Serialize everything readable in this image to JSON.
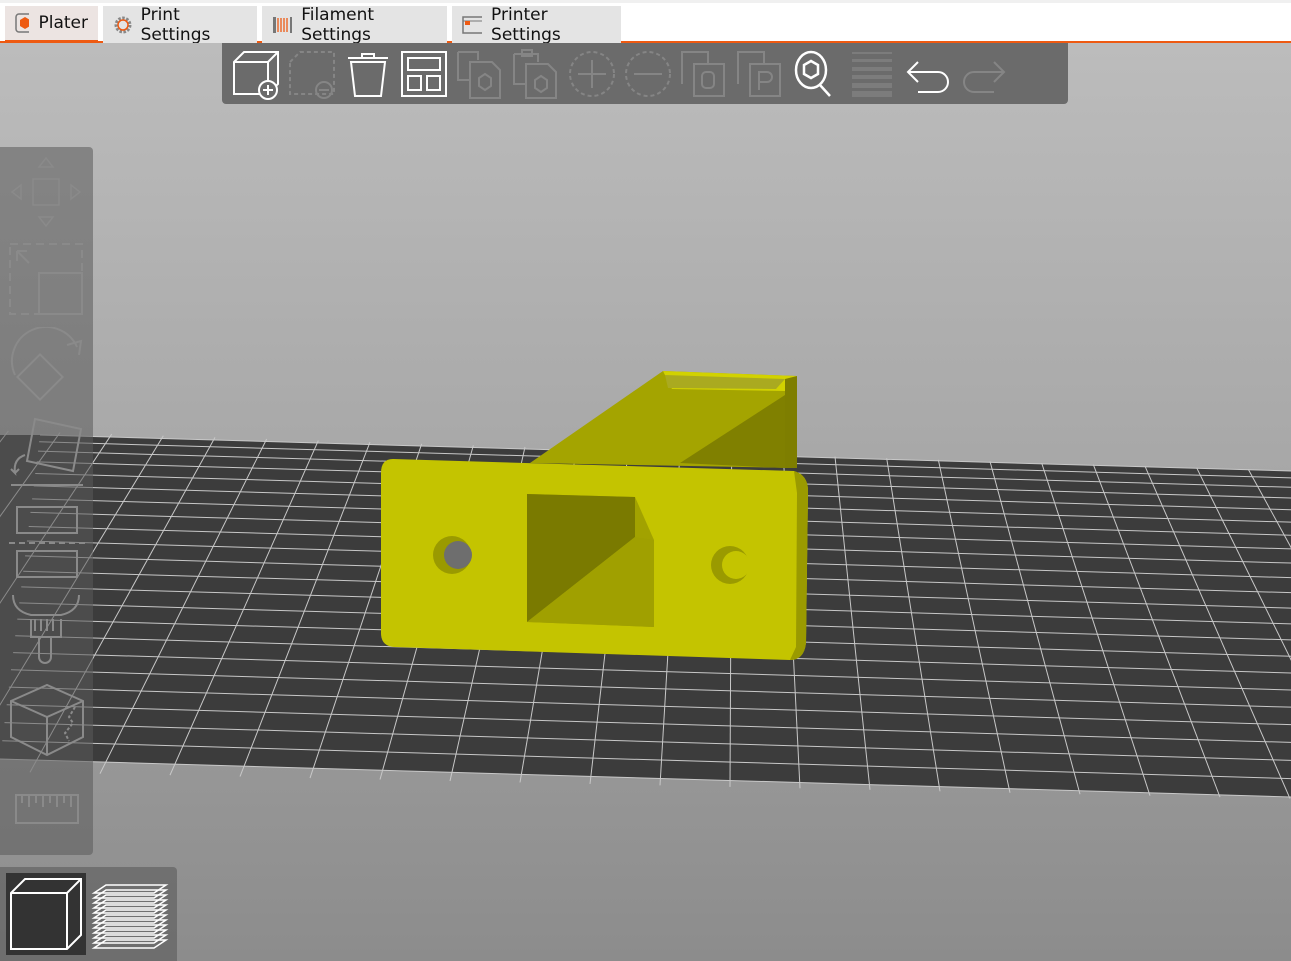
{
  "tabs": [
    {
      "label": "Plater",
      "icon": "plater-icon"
    },
    {
      "label": "Print Settings",
      "icon": "gear-icon"
    },
    {
      "label": "Filament Settings",
      "icon": "filament-spool-icon"
    },
    {
      "label": "Printer Settings",
      "icon": "printer-icon"
    }
  ],
  "toolbar": [
    "add-object",
    "delete-object",
    "delete-all",
    "arrange",
    "copy",
    "paste",
    "add-instance",
    "remove-instance",
    "split-to-objects",
    "split-to-parts",
    "search",
    "layer-editing",
    "undo",
    "redo"
  ],
  "sidebar_tools": [
    "move",
    "scale",
    "rotate",
    "place-on-face",
    "cut",
    "paint-supports",
    "seam-painting",
    "measure"
  ],
  "view_switch": [
    "3d-view",
    "preview-layers"
  ],
  "colors": {
    "accent": "#ee5a12",
    "model": "#c4c400",
    "bed": "#3c3c3c"
  }
}
